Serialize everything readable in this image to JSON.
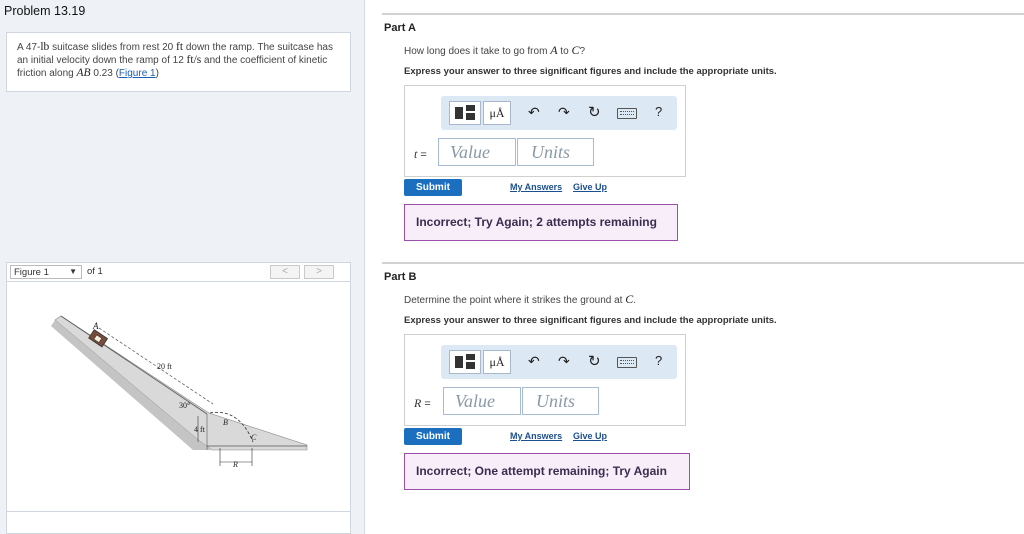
{
  "problem": {
    "title": "Problem 13.19",
    "text": {
      "t1": "A 47-",
      "t2": "lb",
      "t3": " suitcase slides from rest 20 ",
      "t4": "ft",
      "t5": " down the ramp. The suitcase has an initial velocity down the ramp of 12 ",
      "t6": "ft/s",
      "t7": " and the coefficient of kinetic friction along ",
      "t8": "AB",
      "t9": " 0.23 (",
      "link": "Figure 1",
      "t10": ")"
    }
  },
  "figure_nav": {
    "selected": "Figure 1",
    "of": "of 1",
    "prev": "<",
    "next": ">"
  },
  "figure": {
    "label_a": "A",
    "label_b": "B",
    "label_c": "C",
    "dist_ramp": "20 ft",
    "angle": "30°",
    "height": "4 ft",
    "range": "R"
  },
  "toolbar": {
    "template_icon": "template-icon",
    "units_button": "μÅ",
    "undo_icon": "↶",
    "redo_icon": "↷",
    "reset_icon": "↻",
    "keyboard_icon": "keyboard-icon",
    "help": "?"
  },
  "part_a": {
    "title": "Part A",
    "question": {
      "q1": "How long does it take to go from ",
      "m1": "A",
      "q2": " to ",
      "m2": "C",
      "q3": "?"
    },
    "instruction": "Express your answer to three significant figures and include the appropriate units.",
    "var": "t",
    "eq": " =",
    "value_placeholder": "Value",
    "units_placeholder": "Units",
    "submit": "Submit",
    "my_answers": "My Answers",
    "give_up": "Give Up",
    "feedback": "Incorrect; Try Again; 2 attempts remaining"
  },
  "part_b": {
    "title": "Part B",
    "question": {
      "q1": "Determine the point where it strikes the ground at ",
      "m1": "C",
      "q2": "."
    },
    "instruction": "Express your answer to three significant figures and include the appropriate units.",
    "var": "R",
    "eq": " =",
    "value_placeholder": "Value",
    "units_placeholder": "Units",
    "submit": "Submit",
    "my_answers": "My Answers",
    "give_up": "Give Up",
    "feedback": "Incorrect; One attempt remaining; Try Again"
  },
  "colors": {
    "accent": "#1c6fbf",
    "panel_bg": "#eef2f6",
    "toolbar_bg": "#dde8f5",
    "feedback_border": "#9c4fa9",
    "feedback_bg": "#f7eef9"
  }
}
